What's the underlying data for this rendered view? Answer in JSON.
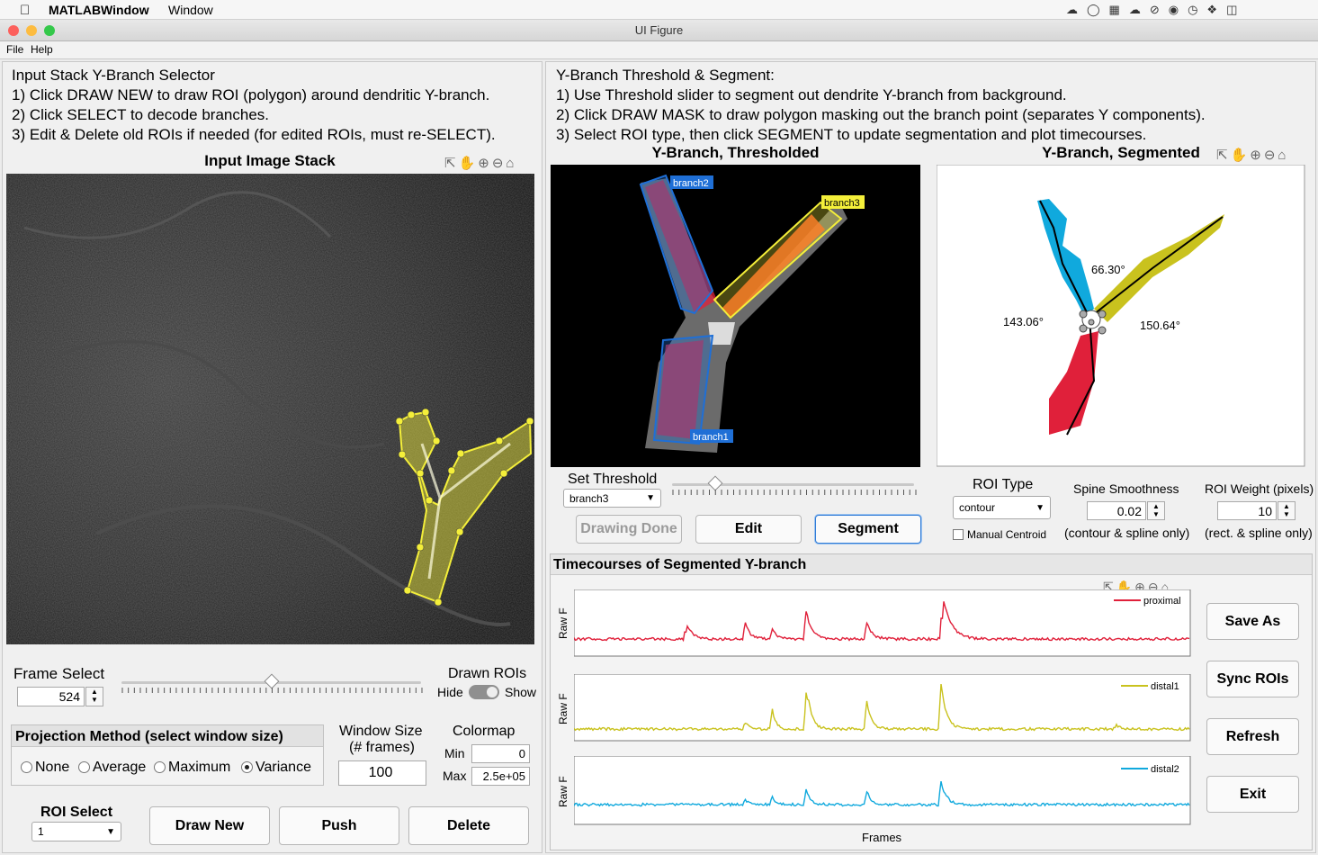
{
  "menubar": {
    "apple": "",
    "app": "MATLABWindow",
    "window": "Window"
  },
  "window": {
    "title": "UI Figure"
  },
  "figmenu": {
    "file": "File",
    "help": "Help"
  },
  "left": {
    "instructions": [
      "Input Stack Y-Branch Selector",
      "1) Click DRAW NEW to draw ROI (polygon) around dendritic Y-branch.",
      "2) Click SELECT to decode branches.",
      "3) Edit & Delete old ROIs if needed (for edited ROIs, must re-SELECT)."
    ],
    "axis_title": "Input Image Stack",
    "frame_select_label": "Frame Select",
    "frame_value": "524",
    "frame_fraction": 0.5,
    "drawn_rois_label": "Drawn ROIs",
    "hide_label": "Hide",
    "show_label": "Show",
    "projection_title": "Projection Method (select window size)",
    "projection_options": [
      "None",
      "Average",
      "Maximum",
      "Variance"
    ],
    "projection_selected": "Variance",
    "window_size_label_1": "Window Size",
    "window_size_label_2": "(# frames)",
    "window_size_value": "100",
    "colormap_label": "Colormap",
    "min_label": "Min",
    "min_value": "0",
    "max_label": "Max",
    "max_value": "2.5e+05",
    "roi_select_label": "ROI Select",
    "roi_select_value": "1",
    "draw_new": "Draw New",
    "push": "Push",
    "delete": "Delete"
  },
  "right": {
    "instructions": [
      "Y-Branch Threshold & Segment:",
      "1) Use Threshold slider to segment out dendrite Y-branch from background.",
      "2) Click DRAW MASK to draw polygon masking out the branch point (separates Y components).",
      "3) Select ROI type, then click SEGMENT to update segmentation and plot timecourses."
    ],
    "thresholded_title": "Y-Branch, Thresholded",
    "segmented_title": "Y-Branch, Segmented",
    "branch_labels": [
      "branch2",
      "branch3",
      "branch1"
    ],
    "angles": [
      "66.30°",
      "143.06°",
      "150.64°"
    ],
    "set_threshold_label": "Set Threshold",
    "threshold_branch": "branch3",
    "threshold_fraction": 0.18,
    "drawing_done": "Drawing Done",
    "edit": "Edit",
    "segment": "Segment",
    "roi_type_label": "ROI Type",
    "roi_type_value": "contour",
    "manual_centroid": "Manual Centroid",
    "spine_smoothness_label": "Spine Smoothness",
    "spine_smoothness_value": "0.02",
    "spine_note": "(contour & spline only)",
    "roi_weight_label": "ROI Weight (pixels)",
    "roi_weight_value": "10",
    "weight_note": "(rect. & spline only)"
  },
  "timecourses": {
    "title": "Timecourses of Segmented Y-branch",
    "ylabel": "Raw F",
    "xlabel": "Frames",
    "traces": [
      {
        "name": "proximal",
        "color": "#e0203a"
      },
      {
        "name": "distal1",
        "color": "#c9c21e"
      },
      {
        "name": "distal2",
        "color": "#10a9dd"
      }
    ],
    "buttons": [
      "Save As",
      "Sync ROIs",
      "Refresh",
      "Exit"
    ]
  },
  "colors": {
    "accent": "#2f7bd6",
    "roi_yellow": "#f4ef3a",
    "branch_blue": "#1f6fd6",
    "segment_red": "#e0203a",
    "segment_cyan": "#10a9dd",
    "segment_yellow": "#c9c21e"
  }
}
